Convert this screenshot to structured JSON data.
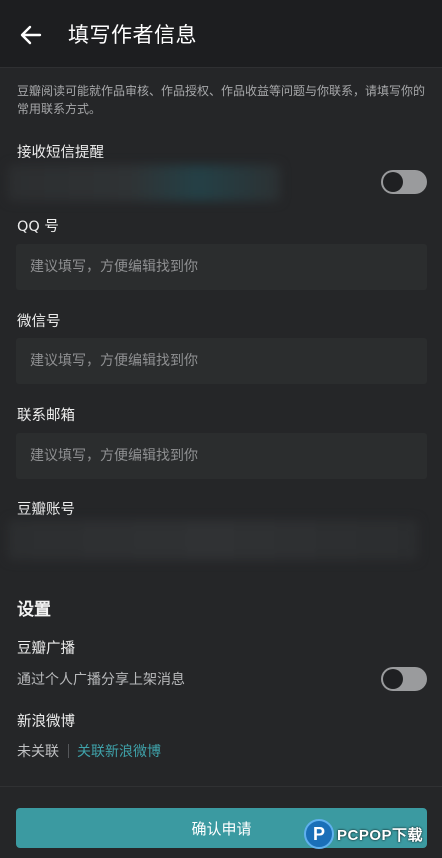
{
  "header": {
    "title": "填写作者信息",
    "back_icon": "arrow-left-icon"
  },
  "intro_text": "豆瓣阅读可能就作品审核、作品授权、作品收益等问题与你联系，请填写你的常用联系方式。",
  "sms": {
    "label": "接收短信提醒",
    "toggle_on": false
  },
  "qq": {
    "label": "QQ 号",
    "placeholder": "建议填写，方便编辑找到你",
    "value": ""
  },
  "wechat": {
    "label": "微信号",
    "placeholder": "建议填写，方便编辑找到你",
    "value": ""
  },
  "email": {
    "label": "联系邮箱",
    "placeholder": "建议填写，方便编辑找到你",
    "value": ""
  },
  "douban_account": {
    "label": "豆瓣账号"
  },
  "settings": {
    "title": "设置",
    "broadcast": {
      "label": "豆瓣广播",
      "description": "通过个人广播分享上架消息",
      "toggle_on": false
    },
    "weibo": {
      "label": "新浪微博",
      "status": "未关联",
      "link": "关联新浪微博"
    }
  },
  "confirm_label": "确认申请",
  "watermark": {
    "letter": "P",
    "text": "PCPOP下载"
  },
  "colors": {
    "accent": "#3b9aa1",
    "link": "#3fa2aa",
    "background": "#252628",
    "header": "#1d1e20"
  }
}
